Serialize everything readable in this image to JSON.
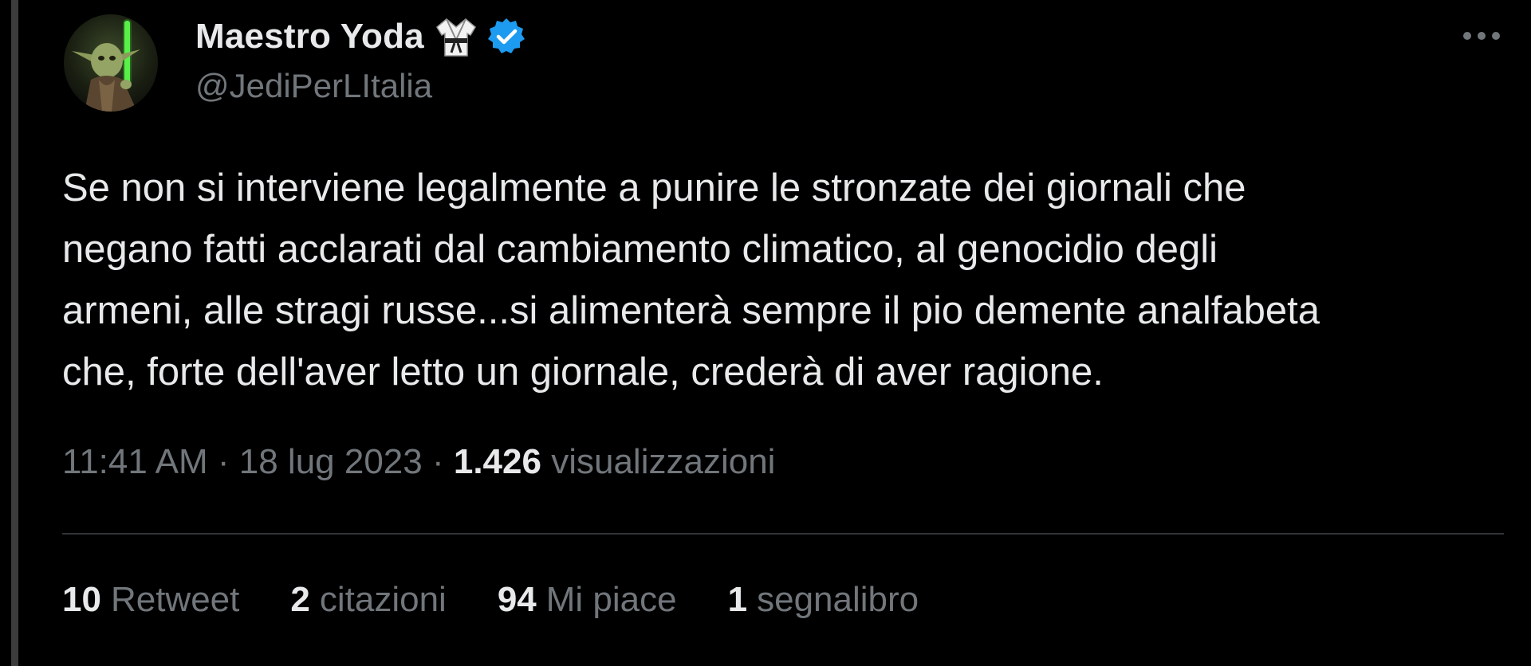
{
  "author": {
    "display_name": "Maestro Yoda",
    "handle": "@JediPerLItalia",
    "avatar_icon": "yoda-avatar",
    "badge_emoji_icon": "martial-arts-uniform-icon",
    "verified_icon": "verified-badge-icon",
    "verified_color": "#1d9bf0"
  },
  "menu": {
    "more_icon": "more-horizontal-icon"
  },
  "tweet": {
    "text": "Se non si interviene legalmente a punire le stronzate dei giornali che\nnegano fatti acclarati dal cambiamento climatico, al genocidio degli\narmeni, alle stragi russe...si alimenterà sempre il pio demente analfabeta\nche, forte dell'aver letto un giornale, crederà di aver ragione."
  },
  "meta": {
    "time": "11:41 AM",
    "separator": " · ",
    "date": "18 lug 2023",
    "views_count": "1.426",
    "views_label": "visualizzazioni"
  },
  "stats": [
    {
      "count": "10",
      "label": "Retweet"
    },
    {
      "count": "2",
      "label": "citazioni"
    },
    {
      "count": "94",
      "label": "Mi piace"
    },
    {
      "count": "1",
      "label": "segnalibro"
    }
  ],
  "colors": {
    "background": "#000000",
    "primary_text": "#e7e9ea",
    "secondary_text": "#71767b",
    "divider": "#2f3336"
  }
}
